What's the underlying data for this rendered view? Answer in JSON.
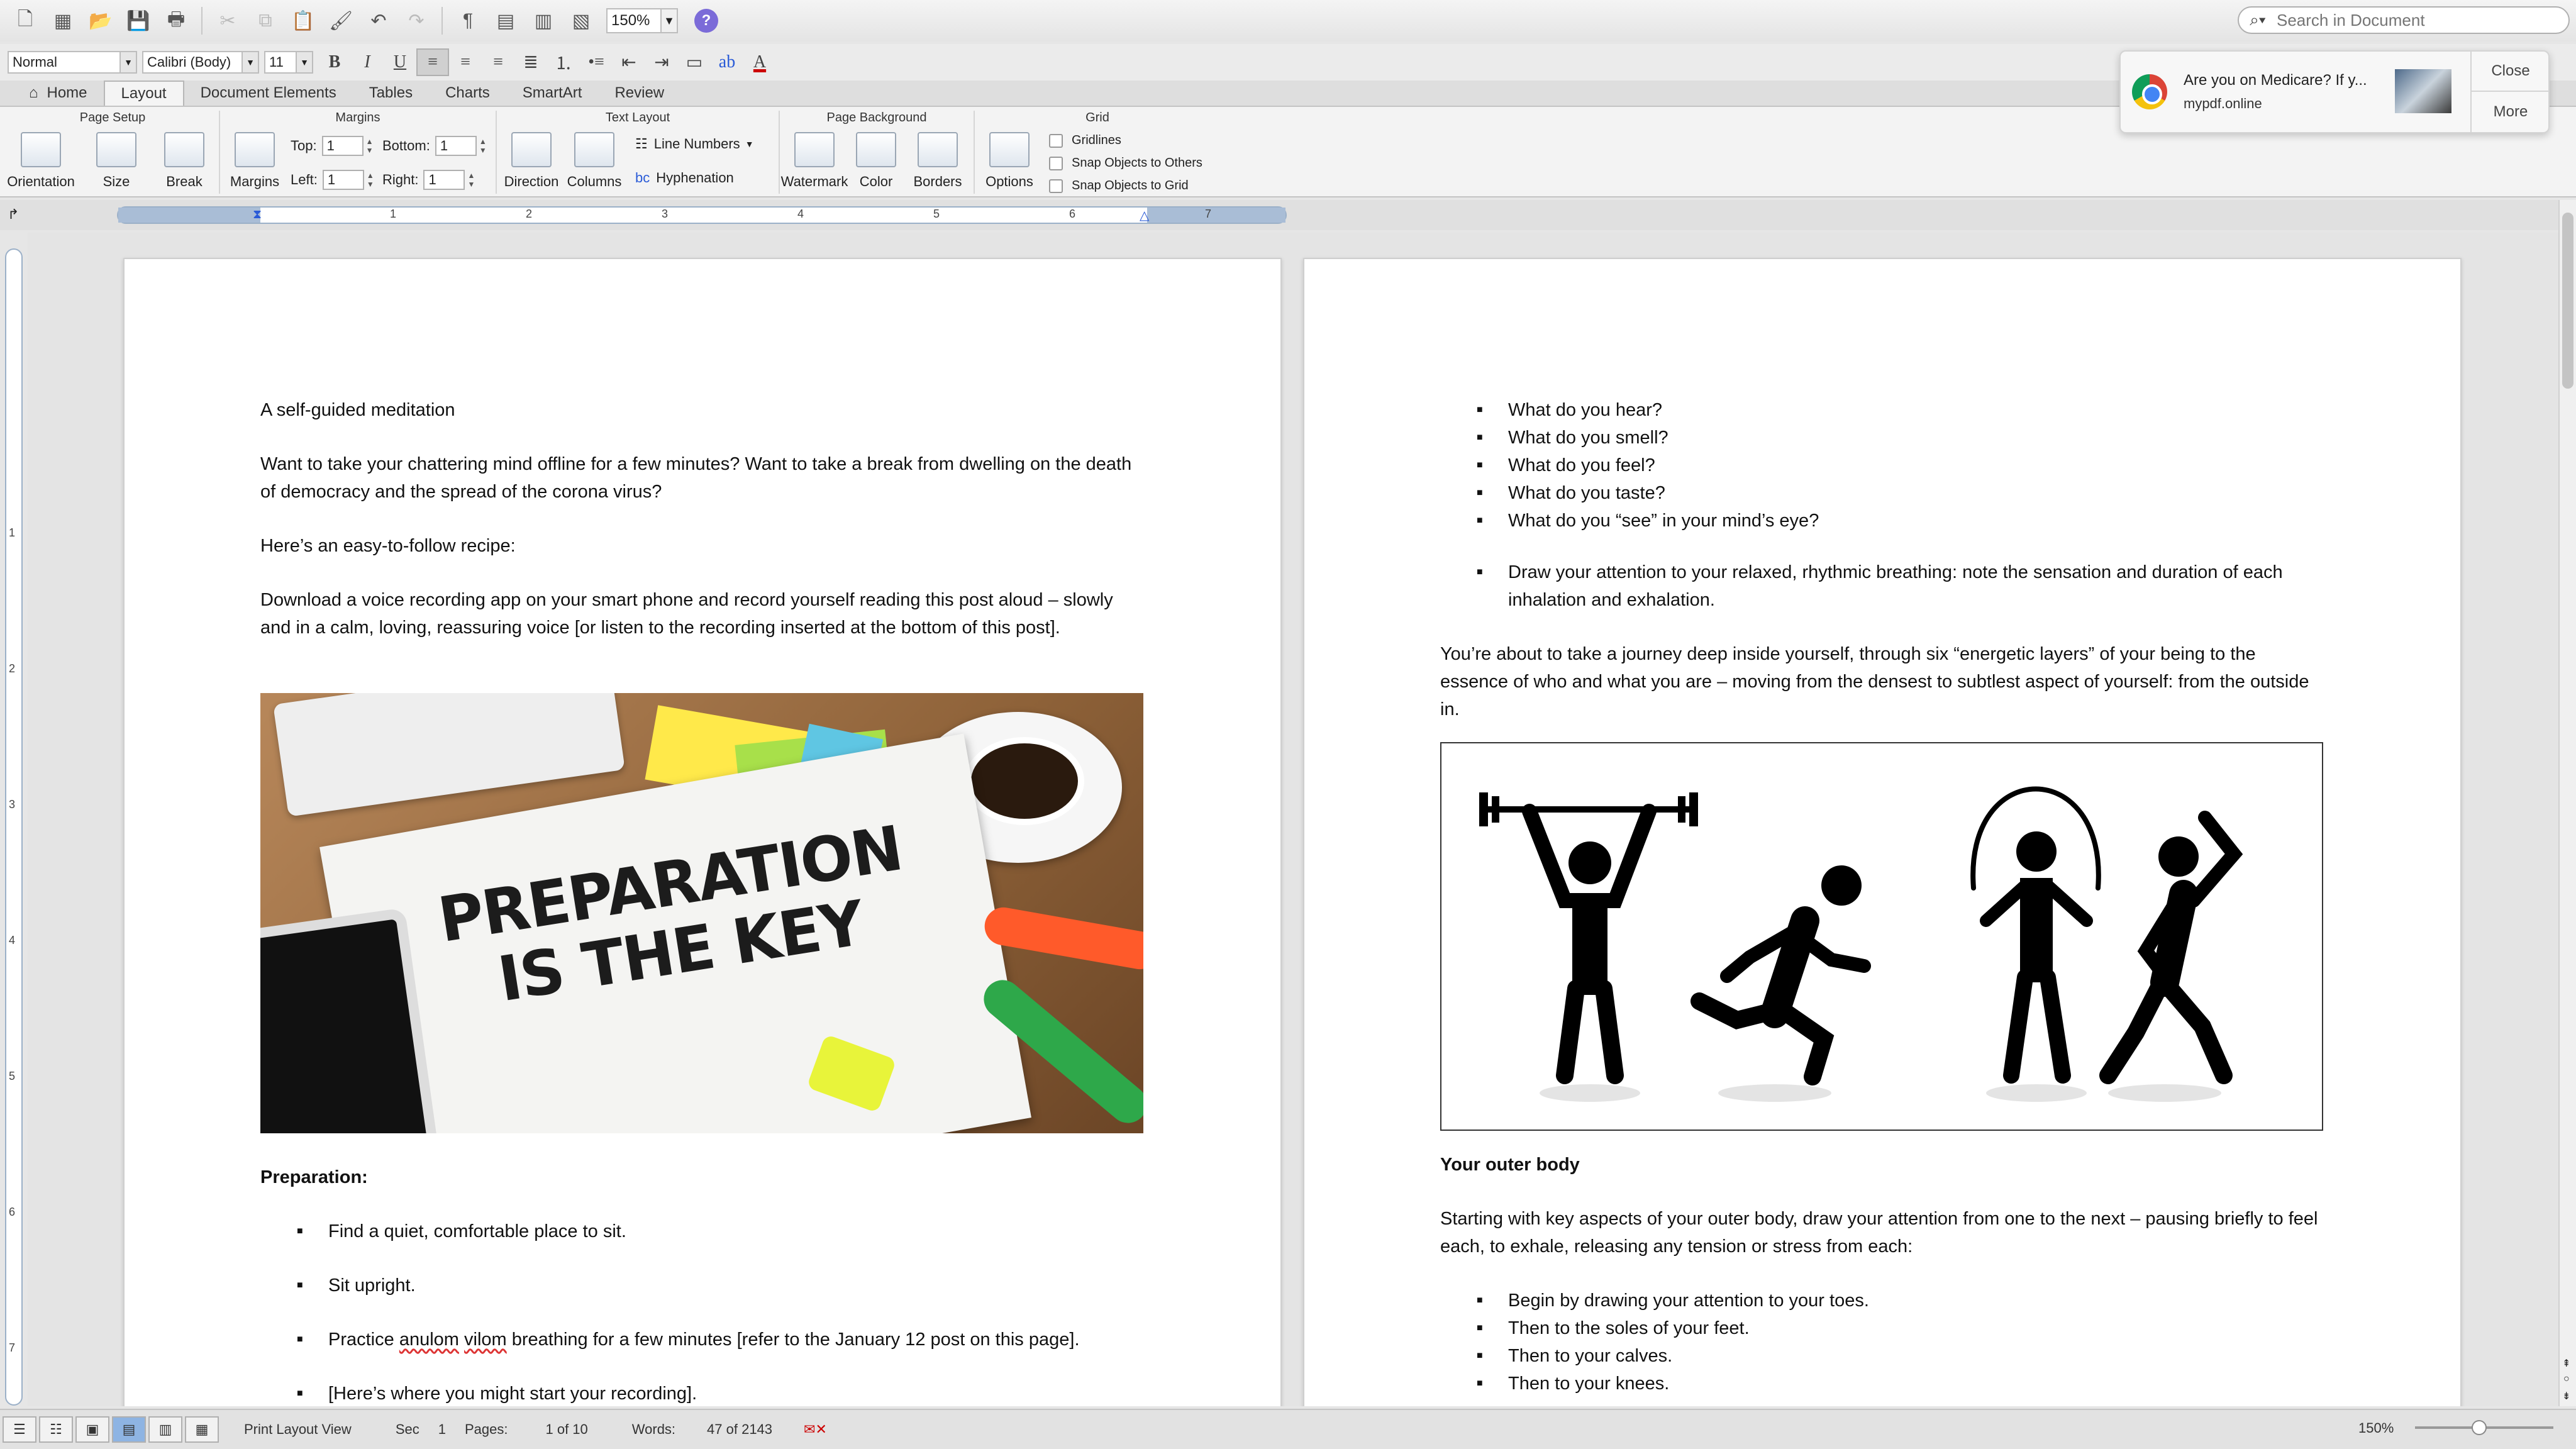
{
  "toolbar": {
    "zoom": "150%",
    "search_placeholder": "Search in Document"
  },
  "format": {
    "style": "Normal",
    "font": "Calibri (Body)",
    "size": "11"
  },
  "ribbon_tabs": [
    "Home",
    "Layout",
    "Document Elements",
    "Tables",
    "Charts",
    "SmartArt",
    "Review"
  ],
  "ribbon": {
    "page_setup": {
      "title": "Page Setup",
      "orientation": "Orientation",
      "size": "Size",
      "break": "Break"
    },
    "margins": {
      "title": "Margins",
      "button": "Margins",
      "top_label": "Top:",
      "top_value": "1",
      "bottom_label": "Bottom:",
      "bottom_value": "1",
      "left_label": "Left:",
      "left_value": "1",
      "right_label": "Right:",
      "right_value": "1"
    },
    "text_layout": {
      "title": "Text Layout",
      "direction": "Direction",
      "columns": "Columns",
      "line_numbers": "Line Numbers",
      "hyphenation": "Hyphenation"
    },
    "page_background": {
      "title": "Page Background",
      "watermark": "Watermark",
      "color": "Color",
      "borders": "Borders"
    },
    "grid": {
      "title": "Grid",
      "options": "Options",
      "gridlines": "Gridlines",
      "snap_others": "Snap Objects to Others",
      "snap_grid": "Snap Objects to Grid"
    }
  },
  "notification": {
    "title": "Are you on Medicare? If y...",
    "source": "mypdf.online",
    "close": "Close",
    "more": "More"
  },
  "ruler_numbers": [
    "1",
    "2",
    "3",
    "4",
    "5",
    "6",
    "7"
  ],
  "vruler_numbers": [
    "1",
    "2",
    "3",
    "4",
    "5",
    "6",
    "7"
  ],
  "page1": {
    "title": "A self-guided meditation",
    "intro": "Want to take your chattering mind offline for a few minutes? Want to take a break from dwelling on the death of democracy and the spread of the corona virus?",
    "recipe": "Here’s an easy-to-follow recipe:",
    "download": "Download a voice recording app on your smart phone and record yourself reading this post aloud – slowly and in a calm, loving, reassuring voice [or listen to the recording inserted at the bottom of this post].",
    "image_text": "PREPARATION IS THE KEY",
    "prep_heading": "Preparation:",
    "prep_items": [
      "Find a quiet, comfortable place to sit.",
      "Sit upright.",
      "Practice anulom vilom breathing for a few minutes [refer to the January 12 post on this page].",
      "[Here’s where you might start your recording]."
    ]
  },
  "page2": {
    "senses": [
      "What do you hear?",
      "What do you smell?",
      "What do you feel?",
      "What do you taste?",
      "What do you “see” in your mind’s eye?"
    ],
    "breathing": "Draw your attention to your relaxed, rhythmic breathing: note the sensation and duration of each inhalation and exhalation.",
    "journey": "You’re about to take a journey deep inside yourself, through six “energetic layers” of your being to the essence of who and what you are – moving from the densest to subtlest aspect of yourself: from the outside in.",
    "outer_heading": "Your outer body",
    "outer_intro": "Starting with key aspects of your outer body, draw your attention from one to the next – pausing briefly to feel each, to exhale, releasing any tension or stress from each:",
    "outer_items": [
      "Begin by drawing your attention to your toes.",
      "Then to the soles of your feet.",
      "Then to your calves.",
      "Then to your knees."
    ]
  },
  "status": {
    "view": "Print Layout View",
    "sec_label": "Sec",
    "sec_value": "1",
    "pages_label": "Pages:",
    "pages_value": "1 of 10",
    "words_label": "Words:",
    "words_value": "47 of 2143",
    "zoom": "150%"
  }
}
